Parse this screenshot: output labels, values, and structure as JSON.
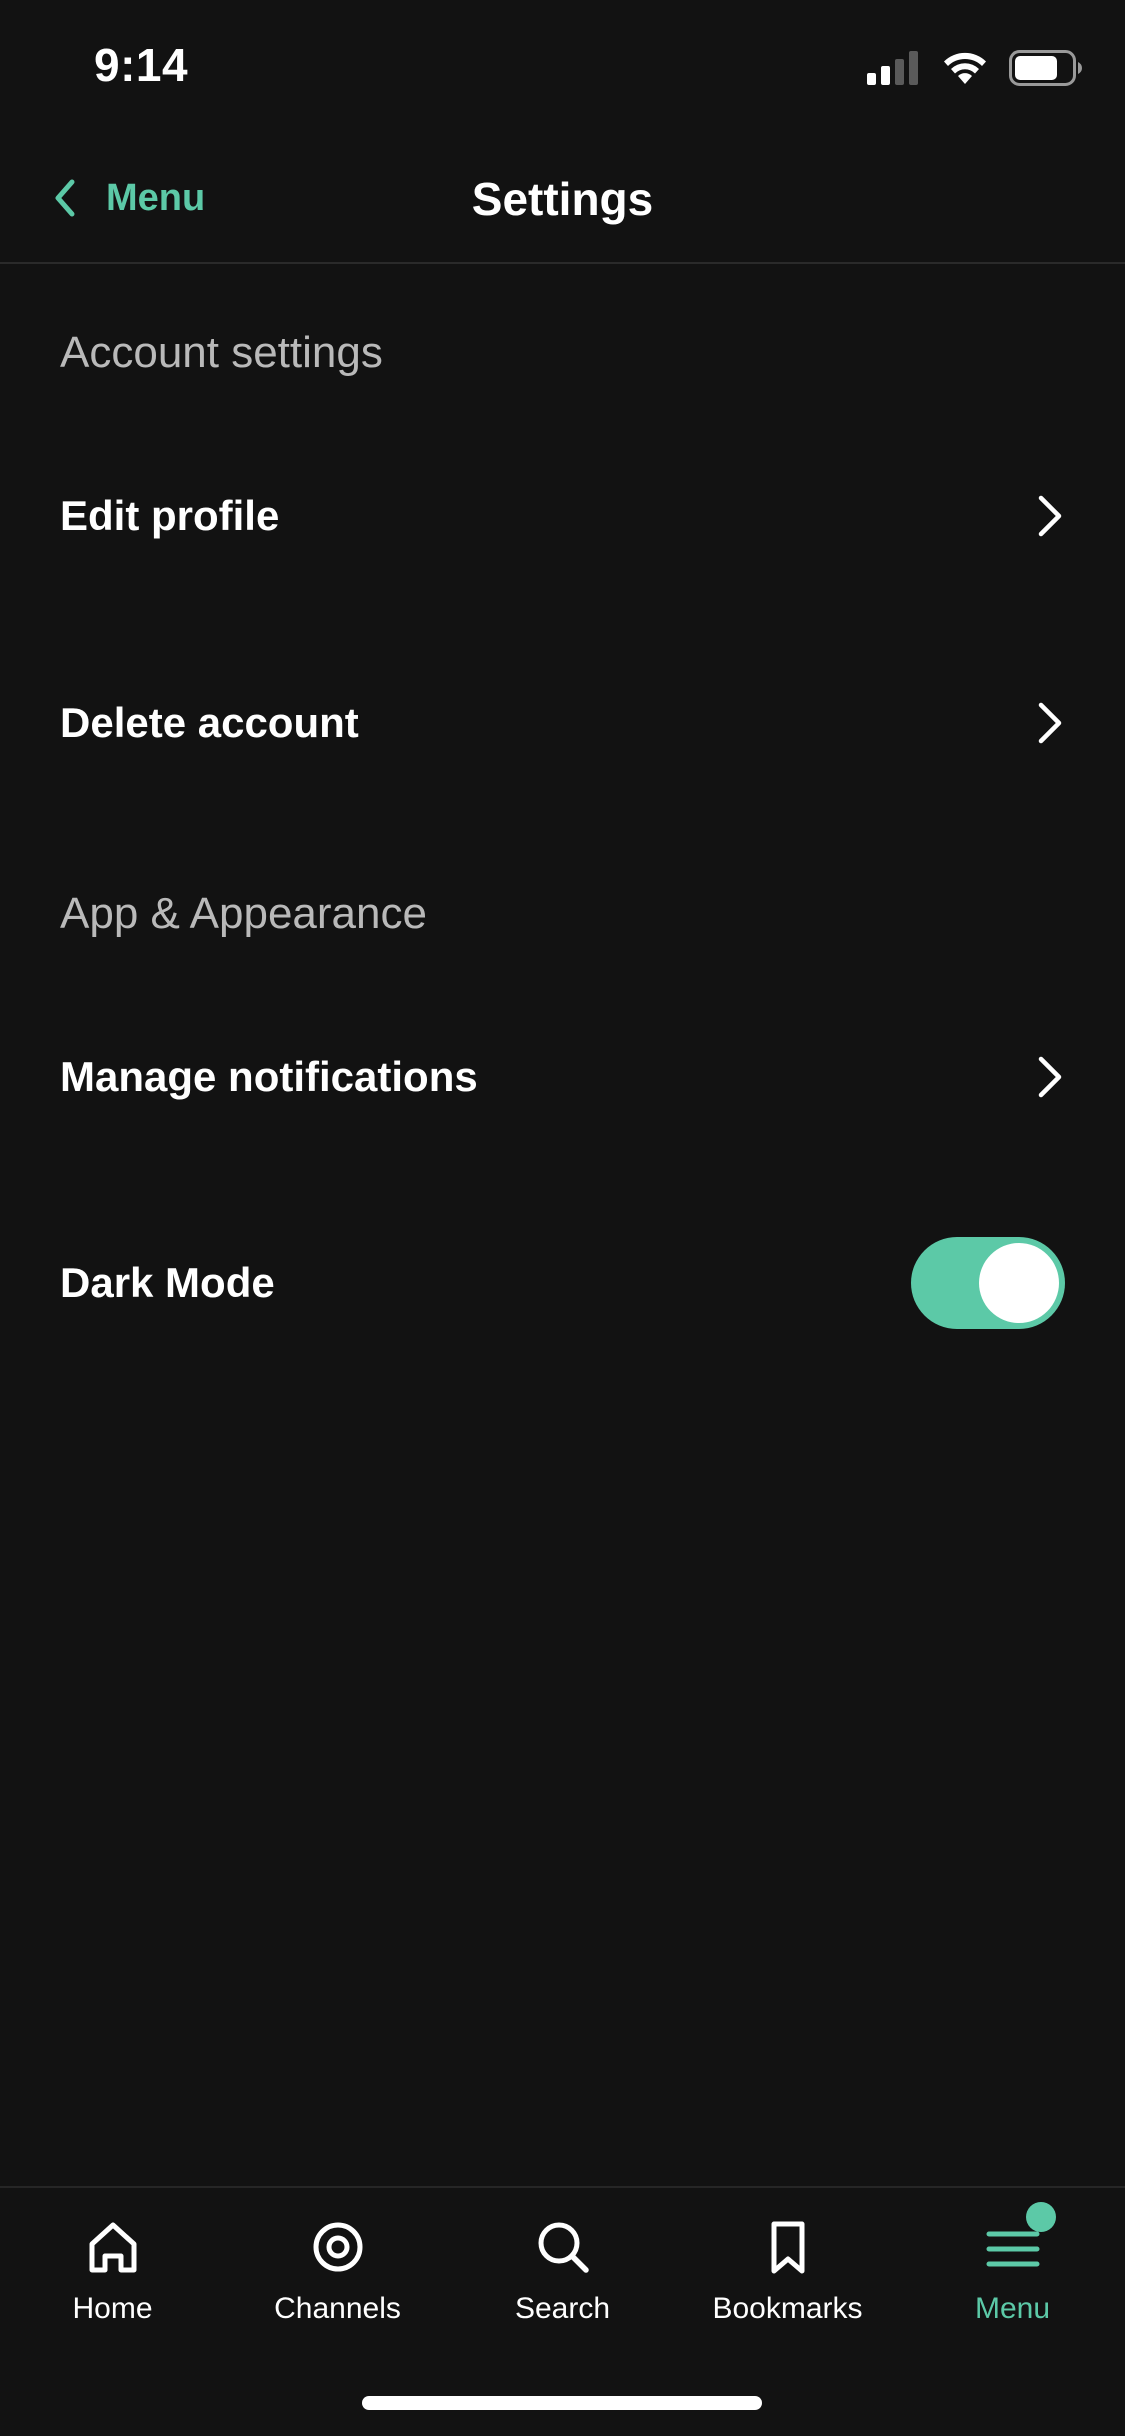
{
  "status": {
    "time": "9:14"
  },
  "nav": {
    "back_label": "Menu",
    "title": "Settings"
  },
  "sections": [
    {
      "header": "Account settings"
    },
    {
      "header": "App & Appearance"
    }
  ],
  "rows": {
    "edit_profile": "Edit profile",
    "delete_account": "Delete account",
    "manage_notifications": "Manage notifications",
    "dark_mode": "Dark Mode"
  },
  "dark_mode_enabled": true,
  "tabs": [
    {
      "label": "Home",
      "icon": "home-icon"
    },
    {
      "label": "Channels",
      "icon": "target-icon"
    },
    {
      "label": "Search",
      "icon": "search-icon"
    },
    {
      "label": "Bookmarks",
      "icon": "bookmark-icon"
    },
    {
      "label": "Menu",
      "icon": "menu-icon",
      "active": true
    }
  ],
  "colors": {
    "accent": "#5cc9a7",
    "background": "#121212",
    "text": "#ffffff",
    "section_text": "#b9b9b9"
  }
}
